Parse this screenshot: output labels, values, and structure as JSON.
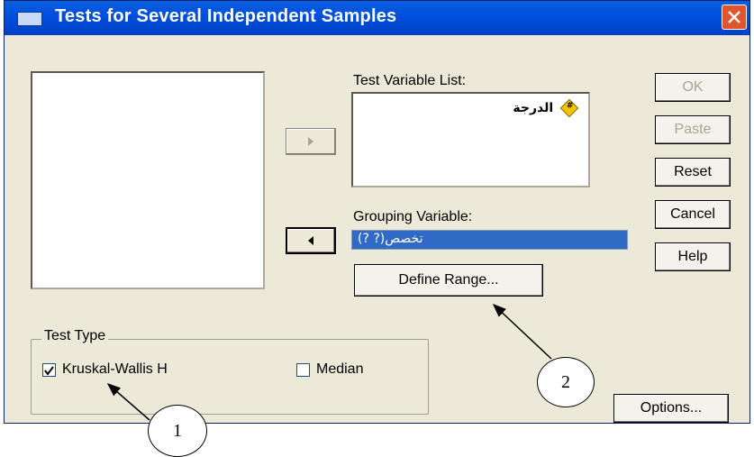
{
  "window": {
    "title": "Tests for Several Independent Samples"
  },
  "labels": {
    "test_variable_list": "Test Variable List:",
    "grouping_variable": "Grouping Variable:"
  },
  "test_variables": [
    {
      "name": "الدرجة",
      "icon": "scale-variable-icon"
    }
  ],
  "grouping_variable_value": "تخصص(? ?)",
  "buttons": {
    "ok": "OK",
    "paste": "Paste",
    "reset": "Reset",
    "cancel": "Cancel",
    "help": "Help",
    "define_range": "Define Range...",
    "options": "Options..."
  },
  "test_type": {
    "legend": "Test Type",
    "kruskal_wallis": {
      "label": "Kruskal-Wallis H",
      "checked": true
    },
    "median": {
      "label": "Median",
      "checked": false
    }
  },
  "callouts": {
    "one": "1",
    "two": "2"
  },
  "colors": {
    "titlebar": "#0050dd",
    "selection": "#316ac5",
    "dialog_bg": "#ece9d8",
    "close": "#e2542b"
  }
}
